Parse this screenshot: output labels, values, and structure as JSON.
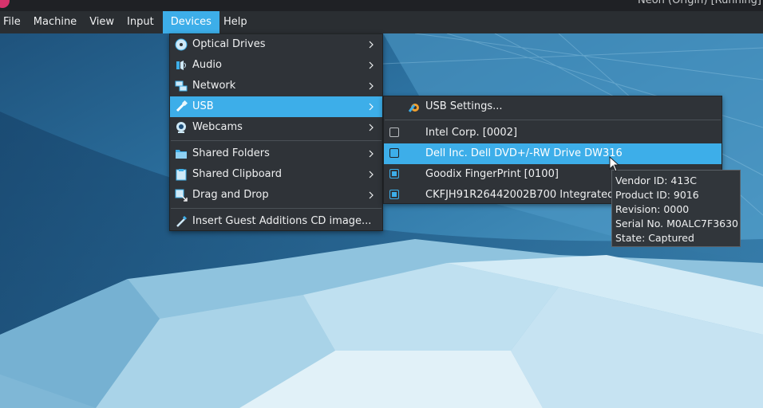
{
  "window": {
    "title": "Neon (Origin) [Running]"
  },
  "menubar": {
    "items": [
      {
        "label": "File"
      },
      {
        "label": "Machine"
      },
      {
        "label": "View"
      },
      {
        "label": "Input"
      },
      {
        "label": "Devices",
        "active": true
      },
      {
        "label": "Help"
      }
    ]
  },
  "devices_menu": {
    "items": [
      {
        "label": "Optical Drives",
        "icon": "optical-disc-icon"
      },
      {
        "label": "Audio",
        "icon": "audio-icon"
      },
      {
        "label": "Network",
        "icon": "network-icon"
      },
      {
        "label": "USB",
        "icon": "usb-icon"
      },
      {
        "label": "Webcams",
        "icon": "webcam-icon"
      },
      {
        "label": "Shared Folders",
        "icon": "shared-folder-icon"
      },
      {
        "label": "Shared Clipboard",
        "icon": "clipboard-icon"
      },
      {
        "label": "Drag and Drop",
        "icon": "drag-drop-icon"
      },
      {
        "label": "Insert Guest Additions CD image...",
        "icon": "guest-additions-icon"
      }
    ]
  },
  "usb_menu": {
    "settings_label": "USB Settings...",
    "devices": [
      {
        "label": "Intel Corp.  [0002]",
        "checked": false
      },
      {
        "label": "Dell Inc. Dell DVD+/-RW Drive DW316",
        "checked": false
      },
      {
        "label": "Goodix FingerPrint [0100]",
        "checked": true
      },
      {
        "label": "CKFJH91R26442002B700 Integrated_W",
        "checked": true
      }
    ]
  },
  "tooltip": {
    "vendor": "Vendor ID: 413C",
    "product": "Product ID: 9016",
    "revision": "Revision: 0000",
    "serial": "Serial No. M0ALC7F3630",
    "state": "State: Captured"
  },
  "colors": {
    "accent": "#3daee9",
    "menu_bg": "#2f3338",
    "menubar_bg": "#2a2e32"
  }
}
